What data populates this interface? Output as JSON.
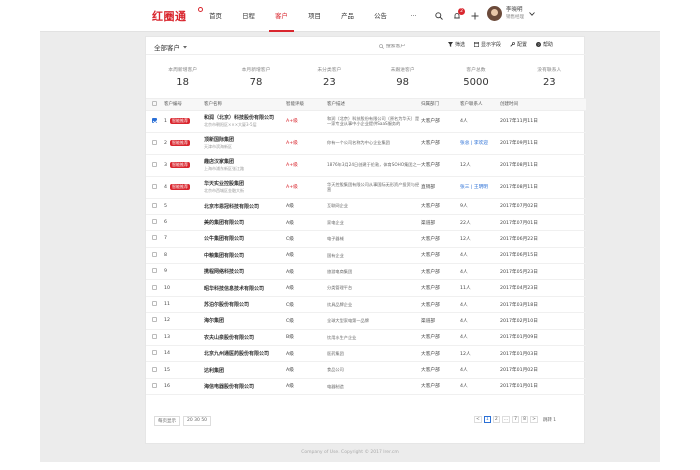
{
  "header": {
    "logo": "红圈通",
    "nav": [
      "首页",
      "日程",
      "客户",
      "项目",
      "产品",
      "公告",
      "···"
    ],
    "active_nav": 2,
    "notification_count": "2",
    "user": {
      "name": "李晓明",
      "role": "销售经理"
    }
  },
  "toolbar": {
    "view_label": "全部客户",
    "search_placeholder": "搜索客户",
    "filter_label": "筛选",
    "fields_label": "显示字段",
    "config_label": "配置",
    "help_label": "帮助"
  },
  "stats": [
    {
      "label": "本周新增客户",
      "value": "18"
    },
    {
      "label": "本月新增客户",
      "value": "78"
    },
    {
      "label": "未分类客户",
      "value": "23"
    },
    {
      "label": "未跟进客户",
      "value": "98"
    },
    {
      "label": "客户总数",
      "value": "5000"
    },
    {
      "label": "没有联系人",
      "value": "23"
    }
  ],
  "table": {
    "columns": [
      "客户编号",
      "客户名称",
      "智能评级",
      "客户描述",
      "归属部门",
      "客户联系人",
      "创建时间"
    ],
    "rows": [
      {
        "no": "1",
        "tag": "智能推荐",
        "checked": true,
        "name": "和润（北京）科技股份有限公司",
        "addr": "北京市朝阳区×××大厦3-5层",
        "level": "A+级",
        "desc": "和润（北京）科技股份有限公司（原名为华天）是一家专业从事中小企业提供SaaS服务的",
        "dept": "大客户部",
        "contact": "4人",
        "date": "2017年11月11日",
        "big": true
      },
      {
        "no": "2",
        "tag": "智能推荐",
        "checked": false,
        "name": "顶新国际集团",
        "addr": "天津市滨海新区",
        "level": "A+级",
        "desc": "你有一个公司名称为中心企业集团",
        "dept": "大客户部",
        "contact": "张总 | 李欢迎",
        "date": "2017年09月11日",
        "big": true
      },
      {
        "no": "3",
        "tag": "智能推荐",
        "checked": false,
        "name": "趣店汉家集团",
        "addr": "上海市浦东新区张江路",
        "level": "A+级",
        "desc": "1876年3月24日创建于伦敦，体育SOHO集团之一",
        "dept": "大客户部",
        "contact": "12人",
        "date": "2017年08月11日",
        "big": true
      },
      {
        "no": "4",
        "tag": "智能推荐",
        "checked": false,
        "name": "华天实业控股集团",
        "addr": "北京市西城区金融大街",
        "level": "A+级",
        "desc": "华天控股集团有限公司从事国际无形资产投资与经营",
        "dept": "直销部",
        "contact": "张三 | 王明明",
        "date": "2017年08月11日",
        "big": true
      },
      {
        "no": "5",
        "tag": "",
        "checked": false,
        "name": "北京市恩冠科技有限公司",
        "addr": "",
        "level": "A级",
        "desc": "互联网企业",
        "dept": "大客户部",
        "contact": "9人",
        "date": "2017年07月02日",
        "big": false
      },
      {
        "no": "6",
        "tag": "",
        "checked": false,
        "name": "美的集团有限公司",
        "addr": "",
        "level": "A级",
        "desc": "家电企业",
        "dept": "渠道部",
        "contact": "22人",
        "date": "2017年07月01日",
        "big": false
      },
      {
        "no": "7",
        "tag": "",
        "checked": false,
        "name": "公牛集团有限公司",
        "addr": "",
        "level": "C级",
        "desc": "电子器械",
        "dept": "大客户部",
        "contact": "12人",
        "date": "2017年06月22日",
        "big": false
      },
      {
        "no": "8",
        "tag": "",
        "checked": false,
        "name": "中粮集团有限公司",
        "addr": "",
        "level": "A级",
        "desc": "国有企业",
        "dept": "大客户部",
        "contact": "4人",
        "date": "2017年06月15日",
        "big": false
      },
      {
        "no": "9",
        "tag": "",
        "checked": false,
        "name": "携程网络科技公司",
        "addr": "",
        "level": "A级",
        "desc": "旅游电商集团",
        "dept": "大客户部",
        "contact": "4人",
        "date": "2017年05月23日",
        "big": false
      },
      {
        "no": "10",
        "tag": "",
        "checked": false,
        "name": "昭华科技信息技术有限公司",
        "addr": "",
        "level": "A级",
        "desc": "分类管理平台",
        "dept": "大客户部",
        "contact": "11人",
        "date": "2017年04月23日",
        "big": false
      },
      {
        "no": "11",
        "tag": "",
        "checked": false,
        "name": "苏泊尔股份有限公司",
        "addr": "",
        "level": "C级",
        "desc": "炊具品牌企业",
        "dept": "大客户部",
        "contact": "4人",
        "date": "2017年03月18日",
        "big": false
      },
      {
        "no": "12",
        "tag": "",
        "checked": false,
        "name": "海尔集团",
        "addr": "",
        "level": "C级",
        "desc": "全球大型家电第一品牌",
        "dept": "渠道部",
        "contact": "4人",
        "date": "2017年02月10日",
        "big": false
      },
      {
        "no": "13",
        "tag": "",
        "checked": false,
        "name": "农夫山泉股份有限公司",
        "addr": "",
        "level": "B级",
        "desc": "饮用水生产企业",
        "dept": "大客户部",
        "contact": "4人",
        "date": "2017年01月09日",
        "big": false
      },
      {
        "no": "14",
        "tag": "",
        "checked": false,
        "name": "北京九州通医药股份有限公司",
        "addr": "",
        "level": "A级",
        "desc": "医药集团",
        "dept": "大客户部",
        "contact": "12人",
        "date": "2017年01月03日",
        "big": false
      },
      {
        "no": "15",
        "tag": "",
        "checked": false,
        "name": "达利集团",
        "addr": "",
        "level": "A级",
        "desc": "食品公司",
        "dept": "大客户部",
        "contact": "4人",
        "date": "2017年01月02日",
        "big": false
      },
      {
        "no": "16",
        "tag": "",
        "checked": false,
        "name": "海信电器股份有限公司",
        "addr": "",
        "level": "A级",
        "desc": "电器制造",
        "dept": "大客户部",
        "contact": "4人",
        "date": "2017年01月01日",
        "big": false
      }
    ]
  },
  "pager": {
    "per_page_label": "每页显示",
    "per_page_options": "20  30  50",
    "pages": [
      "<",
      "1",
      "2",
      "...",
      "7",
      "8",
      ">"
    ],
    "current": "1",
    "goto_label": "跳转 1"
  },
  "footer": "Company of Use. Copyright © 2017 lrer.cm"
}
